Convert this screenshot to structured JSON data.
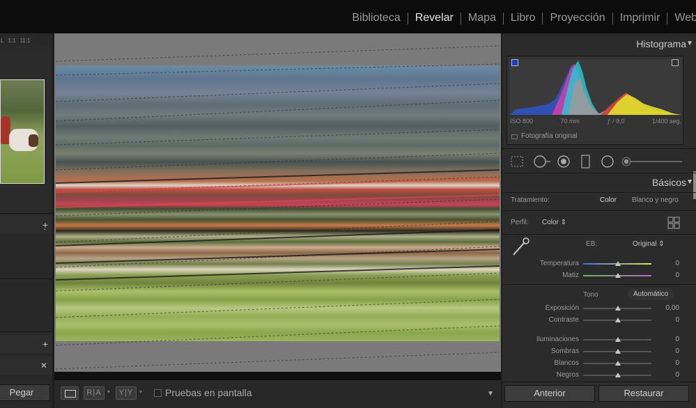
{
  "modules": [
    "Biblioteca",
    "Revelar",
    "Mapa",
    "Libro",
    "Proyección",
    "Imprimir",
    "Web"
  ],
  "active_module": "Revelar",
  "navigator": {
    "zoom_options": [
      "L",
      "1:1",
      "11:1"
    ]
  },
  "left_panel": {
    "paste_button": "Pegar"
  },
  "toolbar": {
    "before_after_1": "R|A",
    "before_after_2": "Y|Y",
    "soft_proofing_label": "Pruebas en pantalla"
  },
  "histogram": {
    "title": "Histograma",
    "iso": "ISO 800",
    "focal_length": "70 mm",
    "aperture": "ƒ / 9,0",
    "shutter": "1/400 seg.",
    "original_label": "Fotografía original"
  },
  "basics": {
    "title": "Básicos",
    "treatment_label": "Tratamiento:",
    "treatment_color": "Color",
    "treatment_bw": "Blanco y negro",
    "profile_label": "Perfil:",
    "profile_value": "Color ⇕",
    "wb_label": "EB:",
    "wb_value": "Original ⇕",
    "tone_label": "Tono",
    "auto_label": "Automático",
    "sliders": {
      "temperatura": {
        "label": "Temperatura",
        "value": "0"
      },
      "matiz": {
        "label": "Matiz",
        "value": "0"
      },
      "exposicion": {
        "label": "Exposición",
        "value": "0,00"
      },
      "contraste": {
        "label": "Contraste",
        "value": "0"
      },
      "iluminaciones": {
        "label": "Iluminaciones",
        "value": "0"
      },
      "sombras": {
        "label": "Sombras",
        "value": "0"
      },
      "blancos": {
        "label": "Blancos",
        "value": "0"
      },
      "negros": {
        "label": "Negros",
        "value": "0"
      }
    }
  },
  "bottom_buttons": {
    "previous": "Anterior",
    "reset": "Restaurar"
  },
  "icons": [
    "paste-icon",
    "plus-icon",
    "close-icon",
    "loupe-view-icon",
    "dropdown-caret-icon",
    "crop-icon",
    "spot-removal-icon",
    "red-eye-icon",
    "graduated-filter-icon",
    "radial-filter-icon",
    "brush-icon",
    "eyedropper-icon",
    "grid-icon"
  ]
}
